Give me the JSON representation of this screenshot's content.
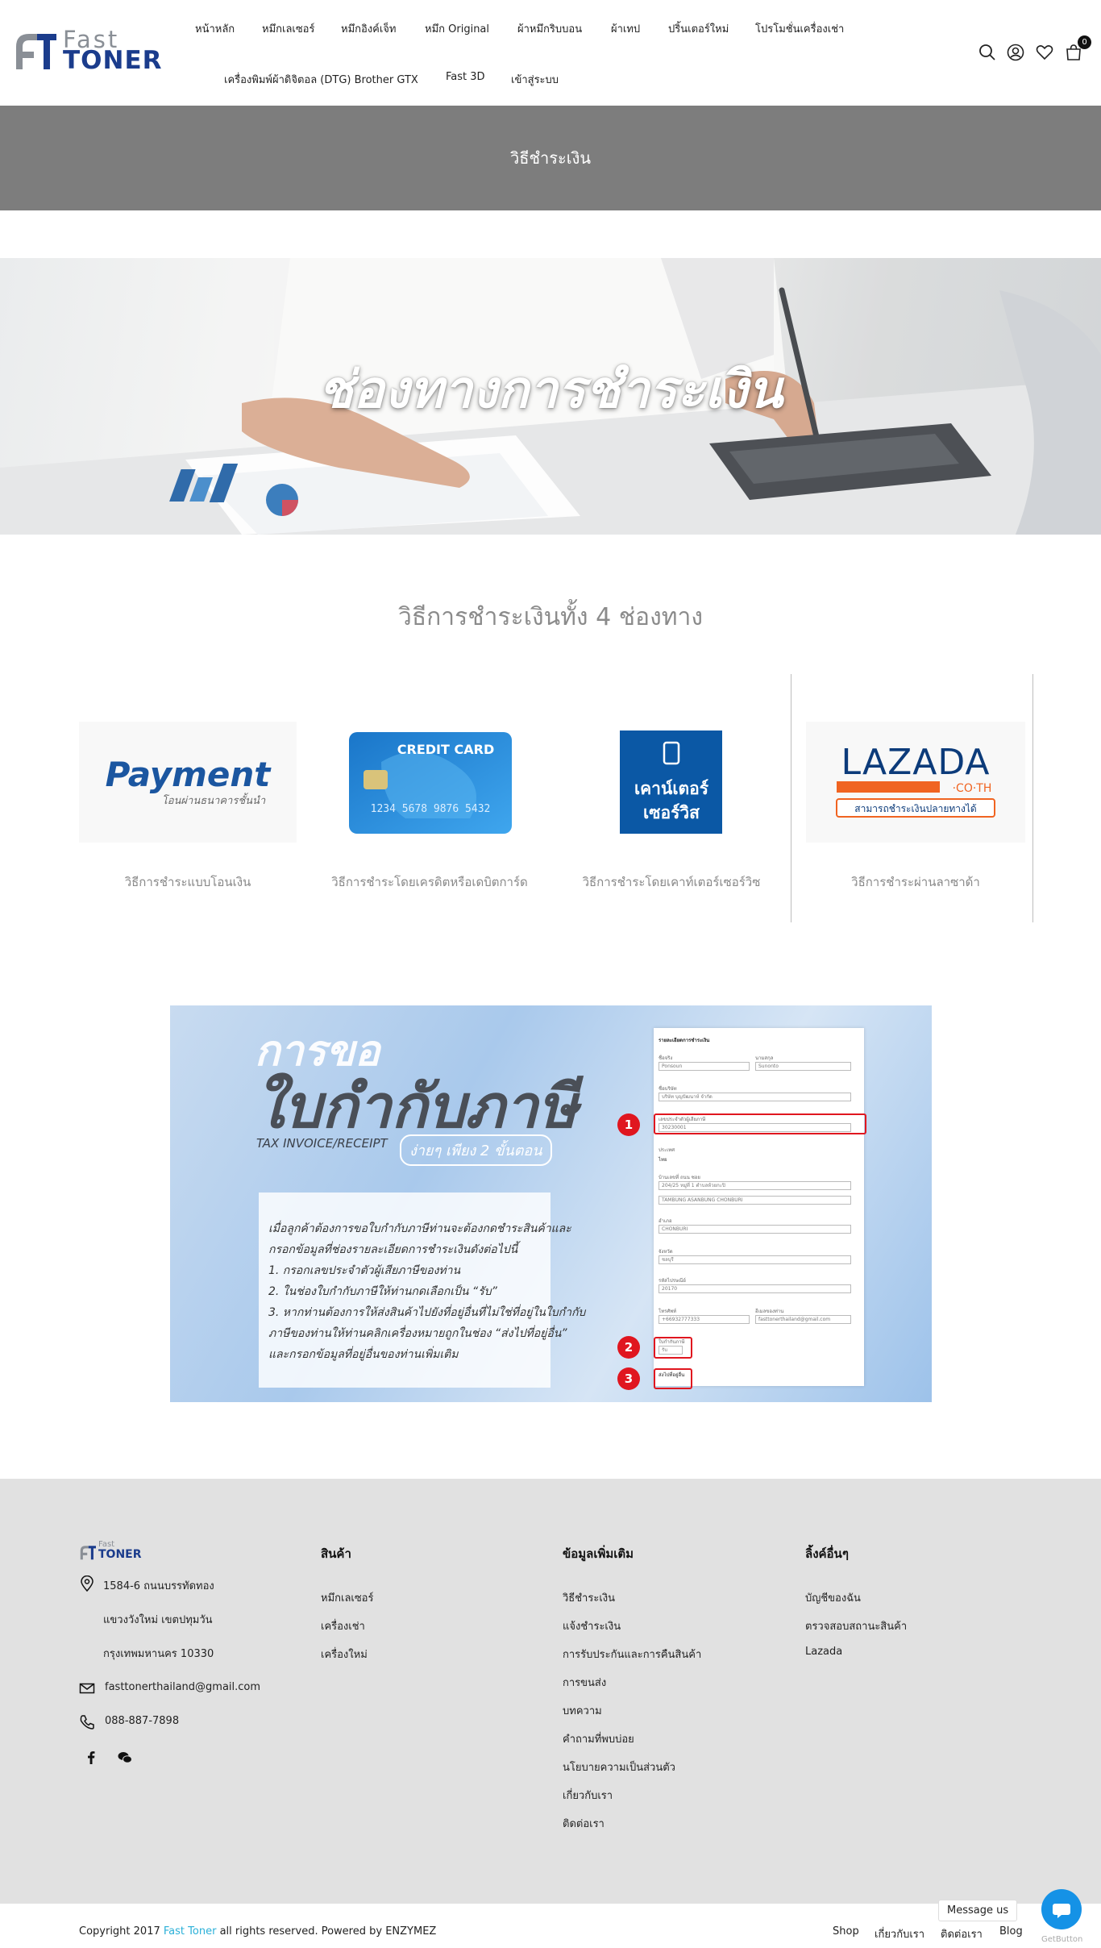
{
  "brand": {
    "logo_word1": "Fast",
    "logo_word2": "TONER",
    "primary_color": "#1b3c8c",
    "accent_color": "#2bb0d8"
  },
  "nav": {
    "items": [
      "หน้าหลัก",
      "หมึกเลเซอร์",
      "หมึกอิงค์เจ็ท",
      "หมึก Original",
      "ผ้าหมึกริบบอน",
      "ผ้าเทป",
      "ปริ้นเตอร์ใหม่",
      "โปรโมชั่นเครื่องเช่า",
      "เครื่องพิมพ์ผ้าดิจิตอล (DTG) Brother GTX",
      "Fast 3D",
      "เข้าสู่ระบบ"
    ],
    "cart_count": "0"
  },
  "page_title": "วิธีชำระเงิน",
  "hero": {
    "text": "ช่องทางการชำระเงิน"
  },
  "section_heading": "วิธีการชำระเงินทั้ง 4 ช่องทาง",
  "methods": [
    {
      "image_text": "Payment",
      "image_subtext": "โอนผ่านธนาคารชั้นนำ",
      "caption": "วิธีการชำระแบบโอนเงิน"
    },
    {
      "image_text": "CREDIT CARD",
      "image_subtext": "1234 5678 9876 5432",
      "caption": "วิธีการชำระโดยเครดิตหรือเดบิตการ์ด"
    },
    {
      "image_text": "เคาน์เตอร์",
      "image_subtext": "เซอร์วิส",
      "caption": "วิธีการชำระโดยเคาท์เตอร์เซอร์วิซ"
    },
    {
      "image_text": "LAZADA",
      "image_subtext": "·CO·TH",
      "image_badge": "สามารถชำระเงินปลายทางได้",
      "caption": "วิธีการชำระผ่านลาซาด้า"
    }
  ],
  "tax_banner": {
    "title1": "การขอ",
    "title2": "ใบกำกับภาษี",
    "subtitle": "TAX INVOICE/RECEIPT",
    "tagline": "ง่ายๆ เพียง 2 ขั้นตอน",
    "lines": [
      "เมื่อลูกค้าต้องการขอใบกำกับภาษีท่านจะต้องกดชำระสินค้าและ",
      "กรอกข้อมูลที่ช่องรายละเอียดการชำระเงินดังต่อไปนี้",
      "1. กรอกเลขประจำตัวผู้เสียภาษีของท่าน",
      "2. ในช่องใบกำกับภาษีให้ท่านกดเลือกเป็น “รับ”",
      "3. หากท่านต้องการให้ส่งสินค้าไปยังที่อยู่อื่นที่ไม่ใช่ที่อยู่ในใบกำกับ",
      "ภาษีของท่านให้ท่านคลิกเครื่องหมายถูกในช่อง “ส่งไปที่อยู่อื่น”",
      "และกรอกข้อมูลที่อยู่อื่นของท่านเพิ่มเติม"
    ],
    "form": {
      "title": "รายละเอียดการชำระเงิน",
      "fields": [
        {
          "label": "ชื่อจริง",
          "value": "Ponsoun"
        },
        {
          "label": "นามสกุล",
          "value": "Sunonto"
        },
        {
          "label": "ชื่อบริษัท",
          "value": "บริษัท บุญปัฒนาห์ จำกัด"
        },
        {
          "label": "เลขประจำตัวผู้เสียภาษี",
          "value": "30230001"
        },
        {
          "label": "ประเทศ",
          "value": "ไทย"
        },
        {
          "label": "บ้านเลขที่ ถนน ซอย",
          "value": "204/25 หมู่ที่ 1 ตำบลห้วยกะปิ"
        },
        {
          "label": "",
          "value": "TAMBUNG ASANBUNG CHONBURI"
        },
        {
          "label": "อำเภอ",
          "value": "CHONBURI"
        },
        {
          "label": "จังหวัด",
          "value": "ชลบุรี"
        },
        {
          "label": "รหัสไปรษณีย์",
          "value": "20170"
        },
        {
          "label": "โทรศัพท์",
          "value": "+66932777333"
        },
        {
          "label": "อีเมลของท่าน",
          "value": "fasttonerthailand@gmail.com"
        },
        {
          "label": "ใบกำกับภาษี",
          "value": "รับ"
        }
      ],
      "ship_other": "ส่งไปที่อยู่อื่น",
      "steps": [
        "1",
        "2",
        "3"
      ]
    }
  },
  "footer": {
    "logo_word1": "Fast",
    "logo_word2": "TONER",
    "address_lines": [
      "1584-6 ถนนบรรทัดทอง",
      "แขวงวังใหม่ เขตปทุมวัน",
      "กรุงเทพมหานคร 10330"
    ],
    "email": "fasttonerthailand@gmail.com",
    "phone": "088-887-7898",
    "columns": [
      {
        "title": "สินค้า",
        "links": [
          "หมึกเลเซอร์",
          "เครื่องเช่า",
          "เครื่องใหม่"
        ]
      },
      {
        "title": "ข้อมูลเพิ่มเติม",
        "links": [
          "วิธีชำระเงิน",
          "แจ้งชำระเงิน",
          "การรับประกันและการคืนสินค้า",
          "การขนส่ง",
          "บทความ",
          "คำถามที่พบบ่อย",
          "นโยบายความเป็นส่วนตัว",
          "เกี่ยวกับเรา",
          "ติดต่อเรา"
        ]
      },
      {
        "title": "ลิ้งค์อื่นๆ",
        "links": [
          "บัญชีของฉัน",
          "ตรวจสอบสถานะสินค้า",
          "Lazada"
        ]
      }
    ],
    "copyright_pre": "Copyright 2017",
    "copyright_brand": "Fast Toner",
    "copyright_post": "all rights reserved. Powered by ENZYMEZ",
    "bottom_links": [
      "Shop",
      "เกี่ยวกับเรา",
      "ติดต่อเรา",
      "Blog"
    ]
  },
  "chat": {
    "bubble": "Message us",
    "powered": "GetButton"
  }
}
